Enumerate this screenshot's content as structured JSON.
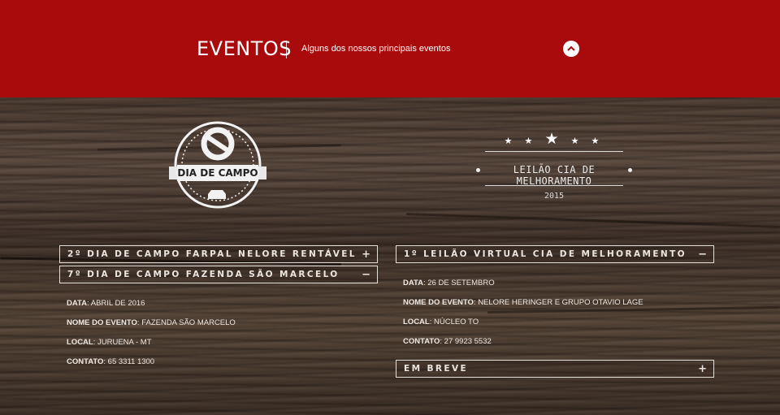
{
  "header": {
    "title": "EVENTOS",
    "subtitle": "Alguns dos nossos principais eventos",
    "up_icon": "chevron-up-icon"
  },
  "logos": {
    "badge_text": "DIA DE CAMPO",
    "leilao_title": "LEILÃO CIA DE MELHORAMENTO",
    "leilao_year": "2015"
  },
  "left": {
    "accordion": [
      {
        "label": "2º DIA DE CAMPO FARPAL NELORE RENTÁVEL",
        "sign": "+"
      },
      {
        "label": "7º DIA DE CAMPO FAZENDA SÃO MARCELO",
        "sign": "−"
      }
    ],
    "details": [
      {
        "key": "DATA",
        "value": ": ABRIL DE 2016"
      },
      {
        "key": "NOME DO EVENTO",
        "value": ": FAZENDA SÃO MARCELO"
      },
      {
        "key": "LOCAL",
        "value": ": JURUENA - MT"
      },
      {
        "key": "CONTATO",
        "value": ": 65 3311 1300"
      }
    ]
  },
  "right": {
    "accordion": [
      {
        "label": "1º LEILÃO VIRTUAL CIA DE MELHORAMENTO",
        "sign": "−"
      },
      {
        "label": "EM BREVE",
        "sign": "+"
      }
    ],
    "details": [
      {
        "key": "DATA",
        "value": ": 26 DE SETEMBRO"
      },
      {
        "key": "NOME DO EVENTO",
        "value": ": NELORE HERINGER E GRUPO OTAVIO LAGE"
      },
      {
        "key": "LOCAL",
        "value": ": NÚCLEO TO"
      },
      {
        "key": "CONTATO",
        "value": ": 27 9923 5532"
      }
    ]
  },
  "colors": {
    "header_red": "#a90b0d",
    "wood_dark": "#3a2c22",
    "text_light": "#efe9e3"
  }
}
